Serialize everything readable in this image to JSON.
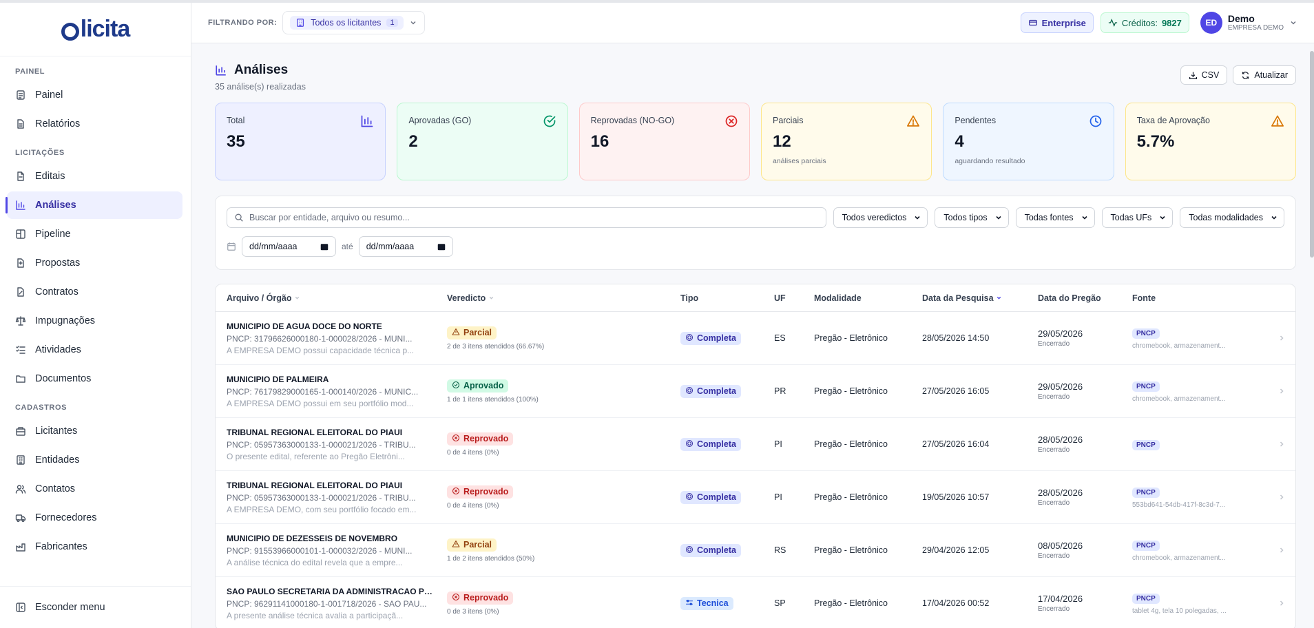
{
  "app": {
    "logo": "licita"
  },
  "sidebar": {
    "sections": [
      {
        "title": "PAINEL",
        "items": [
          {
            "label": "Painel",
            "icon": "dashboard-icon"
          },
          {
            "label": "Relatórios",
            "icon": "report-icon"
          }
        ]
      },
      {
        "title": "LICITAÇÕES",
        "items": [
          {
            "label": "Editais",
            "icon": "document-icon"
          },
          {
            "label": "Análises",
            "icon": "chart-icon",
            "active": true
          },
          {
            "label": "Pipeline",
            "icon": "pipeline-icon"
          },
          {
            "label": "Propostas",
            "icon": "proposal-icon"
          },
          {
            "label": "Contratos",
            "icon": "contract-icon"
          },
          {
            "label": "Impugnações",
            "icon": "scale-icon"
          },
          {
            "label": "Atividades",
            "icon": "tasks-icon"
          },
          {
            "label": "Documentos",
            "icon": "folder-icon"
          }
        ]
      },
      {
        "title": "CADASTROS",
        "items": [
          {
            "label": "Licitantes",
            "icon": "building-icon"
          },
          {
            "label": "Entidades",
            "icon": "institution-icon"
          },
          {
            "label": "Contatos",
            "icon": "users-icon"
          },
          {
            "label": "Fornecedores",
            "icon": "truck-icon"
          },
          {
            "label": "Fabricantes",
            "icon": "factory-icon"
          }
        ]
      }
    ],
    "footer": {
      "label": "Esconder menu",
      "icon": "collapse-icon"
    }
  },
  "topbar": {
    "filter_label": "FILTRANDO POR:",
    "filter_value": "Todos os licitantes",
    "filter_count": "1",
    "plan": "Enterprise",
    "credits_label": "Créditos:",
    "credits_value": "9827",
    "user_initials": "ED",
    "user_name": "Demo",
    "user_company": "EMPRESA DEMO"
  },
  "page": {
    "title": "Análises",
    "subtitle": "35 análise(s) realizadas",
    "csv_label": "CSV",
    "refresh_label": "Atualizar"
  },
  "stats": [
    {
      "label": "Total",
      "value": "35",
      "sub": "",
      "color": "#4f46e5",
      "icon": "chart-icon"
    },
    {
      "label": "Aprovadas (GO)",
      "value": "2",
      "sub": "",
      "color": "#059669",
      "icon": "check-circle-icon"
    },
    {
      "label": "Reprovadas (NO-GO)",
      "value": "16",
      "sub": "",
      "color": "#dc2626",
      "icon": "x-circle-icon"
    },
    {
      "label": "Parciais",
      "value": "12",
      "sub": "análises parciais",
      "color": "#d97706",
      "icon": "warning-icon"
    },
    {
      "label": "Pendentes",
      "value": "4",
      "sub": "aguardando resultado",
      "color": "#2563eb",
      "icon": "clock-icon"
    },
    {
      "label": "Taxa de Aprovação",
      "value": "5.7%",
      "sub": "",
      "color": "#d97706",
      "icon": "warning-icon"
    }
  ],
  "filters": {
    "search_placeholder": "Buscar por entidade, arquivo ou resumo...",
    "selects": [
      "Todos veredictos",
      "Todos tipos",
      "Todas fontes",
      "Todas UFs",
      "Todas modalidades"
    ],
    "date_from": "dd/mm/aaaa",
    "date_sep": "até",
    "date_to": "dd/mm/aaaa"
  },
  "table": {
    "headers": [
      "Arquivo / Órgão",
      "Veredicto",
      "Tipo",
      "UF",
      "Modalidade",
      "Data da Pesquisa",
      "Data do Pregão",
      "Fonte"
    ],
    "rows": [
      {
        "org": "MUNICIPIO DE AGUA DOCE DO NORTE",
        "pncp": "PNCP: 31796626000180-1-000028/2026 - MUNI...",
        "summary": "A EMPRESA DEMO possui capacidade técnica p...",
        "verdict": "Parcial",
        "verdict_kind": "parcial",
        "verdict_sub": "2 de 3 itens atendidos (66.67%)",
        "tipo": "Completa",
        "tipo_kind": "completa",
        "uf": "ES",
        "modalidade": "Pregão - Eletrônico",
        "data_pesquisa": "28/05/2026 14:50",
        "data_pregao": "29/05/2026",
        "pregao_status": "Encerrado",
        "fonte": "PNCP",
        "fonte_sub": "chromebook, armazenament..."
      },
      {
        "org": "MUNICIPIO DE PALMEIRA",
        "pncp": "PNCP: 76179829000165-1-000140/2026 - MUNIC...",
        "summary": "A EMPRESA DEMO possui em seu portfólio mod...",
        "verdict": "Aprovado",
        "verdict_kind": "aprovado",
        "verdict_sub": "1 de 1 itens atendidos (100%)",
        "tipo": "Completa",
        "tipo_kind": "completa",
        "uf": "PR",
        "modalidade": "Pregão - Eletrônico",
        "data_pesquisa": "27/05/2026 16:05",
        "data_pregao": "29/05/2026",
        "pregao_status": "Encerrado",
        "fonte": "PNCP",
        "fonte_sub": "chromebook, armazenament..."
      },
      {
        "org": "TRIBUNAL REGIONAL ELEITORAL DO PIAUI",
        "pncp": "PNCP: 05957363000133-1-000021/2026 - TRIBU...",
        "summary": "O presente edital, referente ao Pregão Eletrôni...",
        "verdict": "Reprovado",
        "verdict_kind": "reprovado",
        "verdict_sub": "0 de 4 itens (0%)",
        "tipo": "Completa",
        "tipo_kind": "completa",
        "uf": "PI",
        "modalidade": "Pregão - Eletrônico",
        "data_pesquisa": "27/05/2026 16:04",
        "data_pregao": "28/05/2026",
        "pregao_status": "Encerrado",
        "fonte": "PNCP",
        "fonte_sub": ""
      },
      {
        "org": "TRIBUNAL REGIONAL ELEITORAL DO PIAUI",
        "pncp": "PNCP: 05957363000133-1-000021/2026 - TRIBU...",
        "summary": "A EMPRESA DEMO, com seu portfólio focado em...",
        "verdict": "Reprovado",
        "verdict_kind": "reprovado",
        "verdict_sub": "0 de 4 itens (0%)",
        "tipo": "Completa",
        "tipo_kind": "completa",
        "uf": "PI",
        "modalidade": "Pregão - Eletrônico",
        "data_pesquisa": "19/05/2026 10:57",
        "data_pregao": "28/05/2026",
        "pregao_status": "Encerrado",
        "fonte": "PNCP",
        "fonte_sub": "553bd641-54db-417f-8c3d-7..."
      },
      {
        "org": "MUNICIPIO DE DEZESSEIS DE NOVEMBRO",
        "pncp": "PNCP: 91553966000101-1-000032/2026 - MUNI...",
        "summary": "A análise técnica do edital revela que a empre...",
        "verdict": "Parcial",
        "verdict_kind": "parcial",
        "verdict_sub": "1 de 2 itens atendidos (50%)",
        "tipo": "Completa",
        "tipo_kind": "completa",
        "uf": "RS",
        "modalidade": "Pregão - Eletrônico",
        "data_pesquisa": "29/04/2026 12:05",
        "data_pregao": "08/05/2026",
        "pregao_status": "Encerrado",
        "fonte": "PNCP",
        "fonte_sub": "chromebook, armazenament..."
      },
      {
        "org": "SAO PAULO SECRETARIA DA ADMINISTRACAO PE...",
        "pncp": "PNCP: 96291141000180-1-001718/2026 - SAO PAU...",
        "summary": "A presente análise técnica avalia a participaçã...",
        "verdict": "Reprovado",
        "verdict_kind": "reprovado",
        "verdict_sub": "0 de 3 itens (0%)",
        "tipo": "Tecnica",
        "tipo_kind": "tecnica",
        "uf": "SP",
        "modalidade": "Pregão - Eletrônico",
        "data_pesquisa": "17/04/2026 00:52",
        "data_pregao": "17/04/2026",
        "pregao_status": "Encerrado",
        "fonte": "PNCP",
        "fonte_sub": "tablet 4g, tela 10 polegadas, ..."
      }
    ]
  }
}
